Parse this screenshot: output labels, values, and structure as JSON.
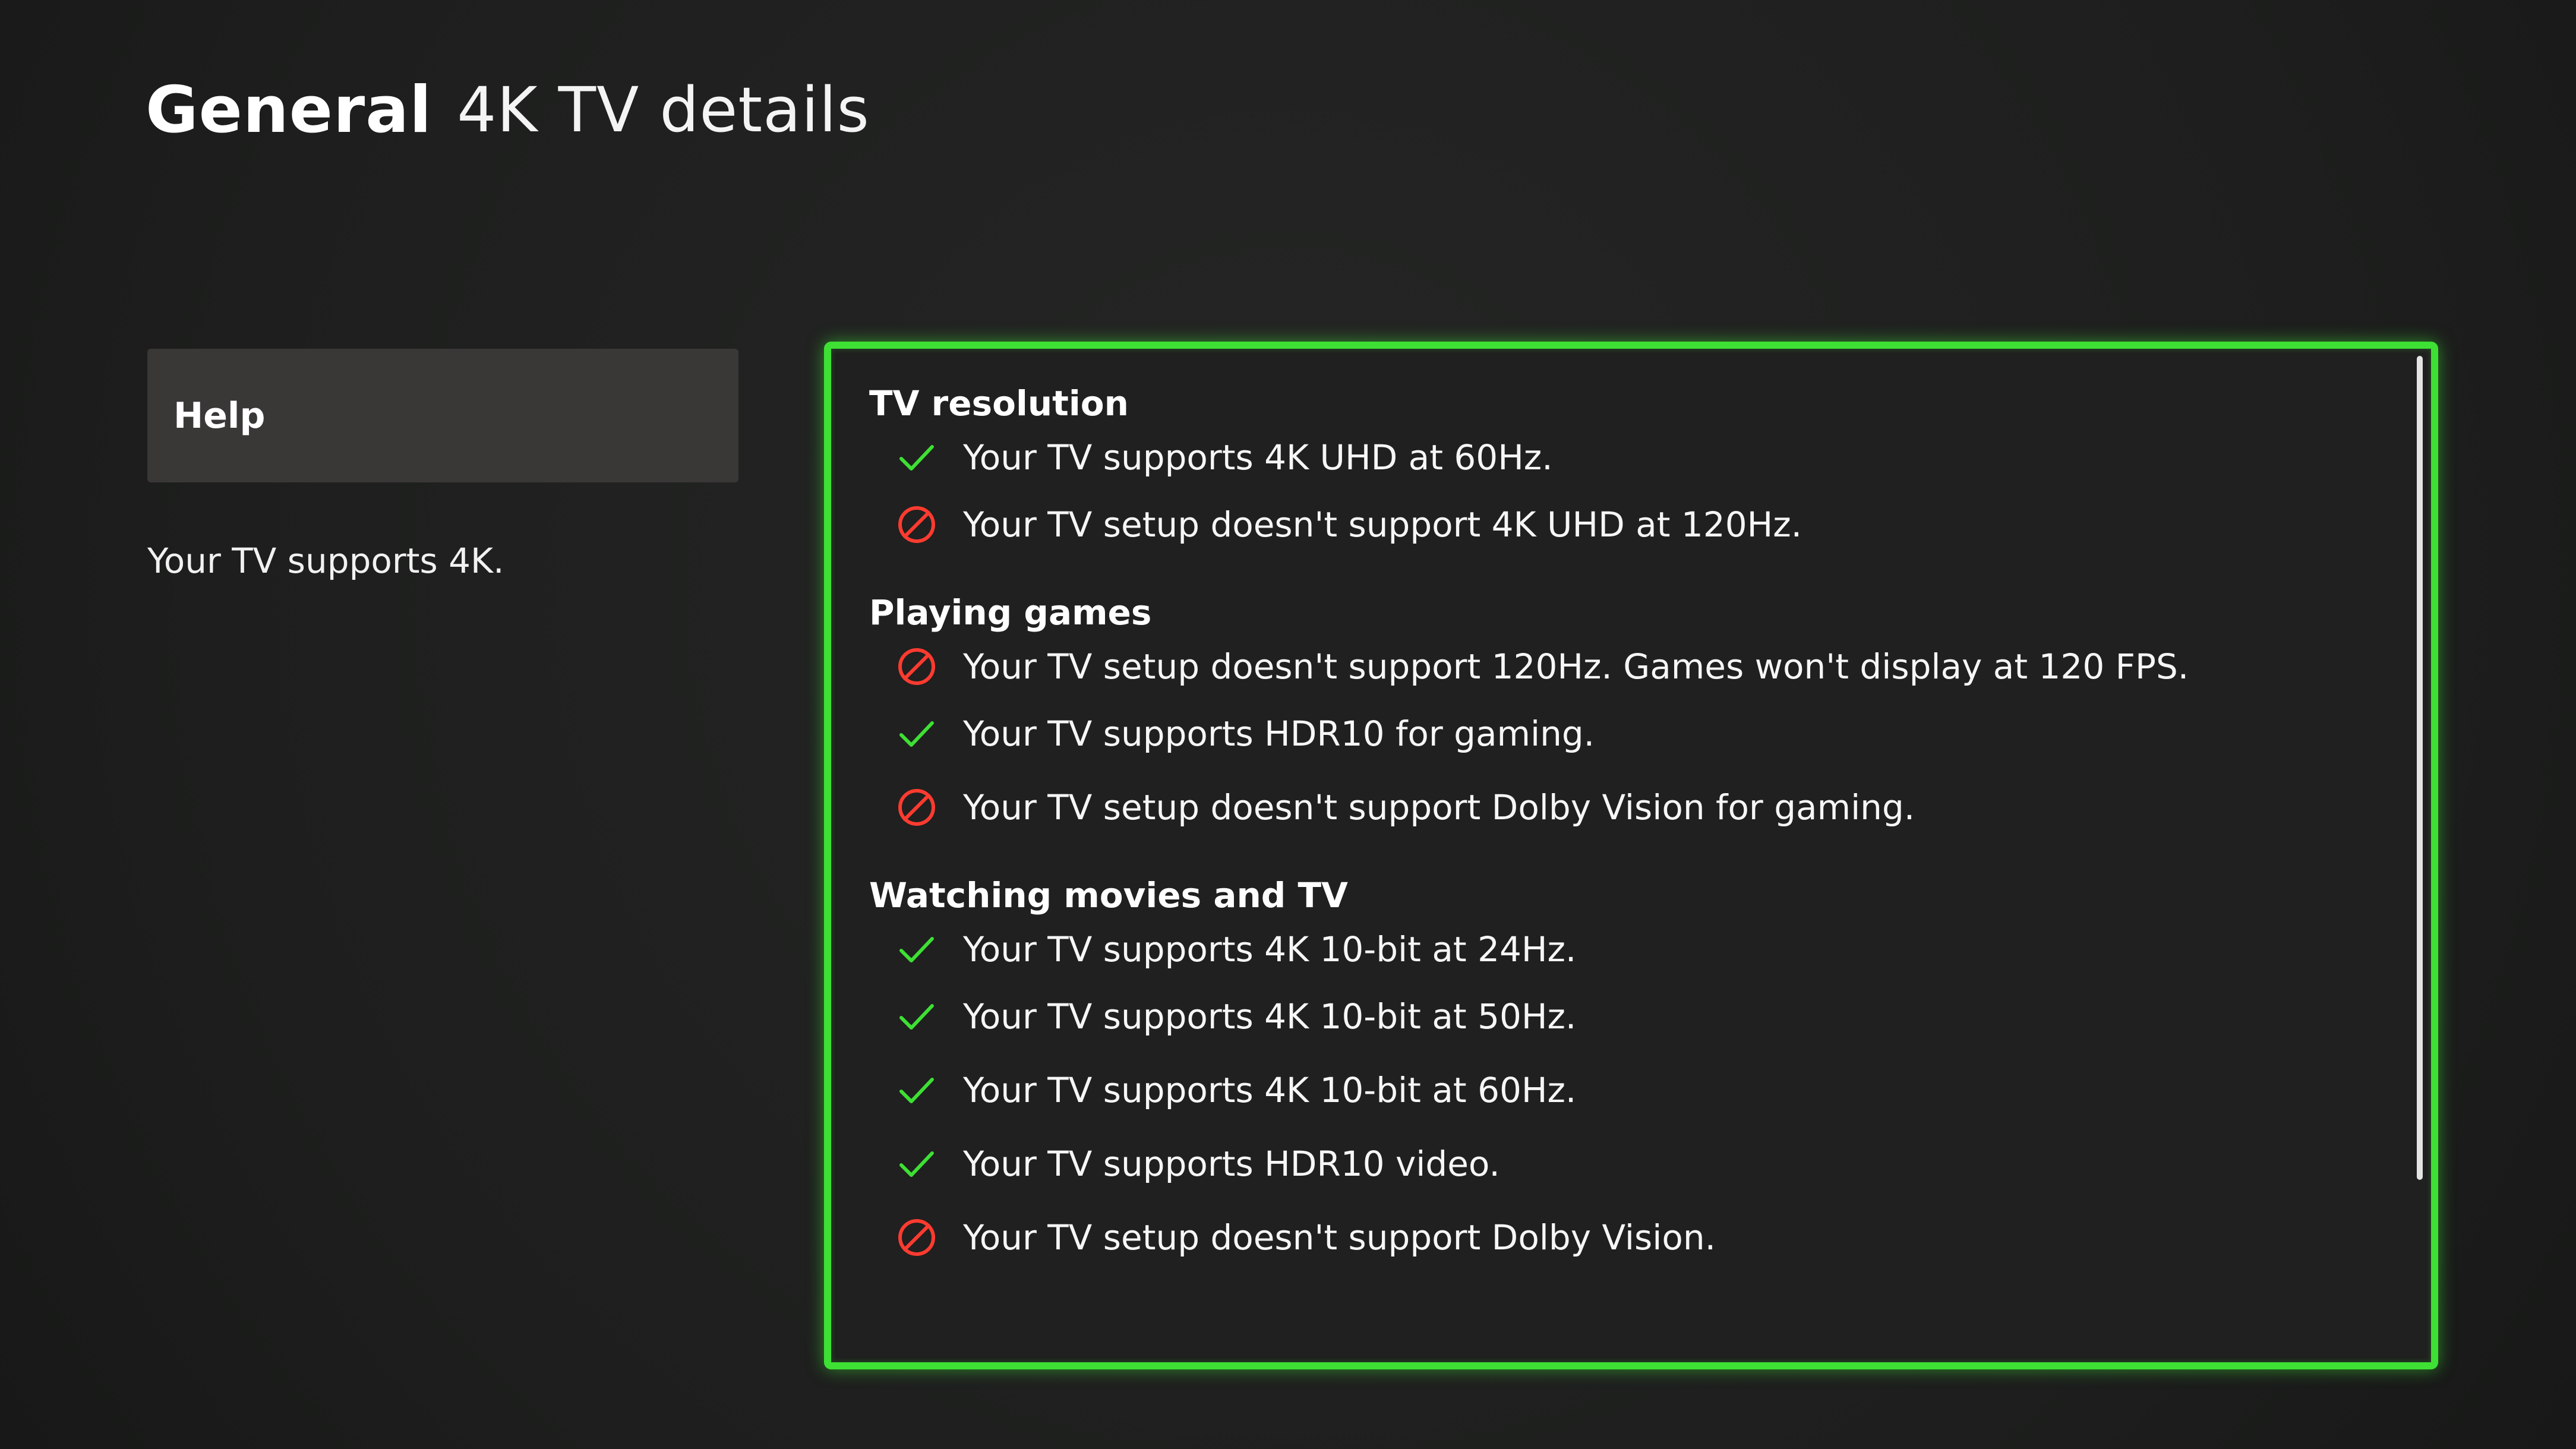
{
  "header": {
    "section": "General",
    "title": "4K TV details"
  },
  "left_pane": {
    "help_label": "Help",
    "summary": "Your TV supports 4K."
  },
  "colors": {
    "accent_green": "#3ee034",
    "unsupported_red": "#ff3b30",
    "background": "#1f201f"
  },
  "sections": [
    {
      "title": "TV resolution",
      "items": [
        {
          "status": "supported",
          "icon": "check-icon",
          "text": "Your TV supports 4K UHD at 60Hz."
        },
        {
          "status": "unsupported",
          "icon": "blocked-icon",
          "text": "Your TV setup doesn't support 4K UHD at 120Hz."
        }
      ]
    },
    {
      "title": "Playing games",
      "items": [
        {
          "status": "unsupported",
          "icon": "blocked-icon",
          "text": "Your TV setup doesn't support 120Hz. Games won't display at 120 FPS."
        },
        {
          "status": "supported",
          "icon": "check-icon",
          "text": "Your TV supports HDR10 for gaming."
        },
        {
          "status": "unsupported",
          "icon": "blocked-icon",
          "text": "Your TV setup doesn't support Dolby Vision for gaming."
        }
      ]
    },
    {
      "title": "Watching movies and TV",
      "items": [
        {
          "status": "supported",
          "icon": "check-icon",
          "text": "Your TV supports 4K 10-bit at 24Hz."
        },
        {
          "status": "supported",
          "icon": "check-icon",
          "text": "Your TV supports 4K 10-bit at 50Hz."
        },
        {
          "status": "supported",
          "icon": "check-icon",
          "text": "Your TV supports 4K 10-bit at 60Hz."
        },
        {
          "status": "supported",
          "icon": "check-icon",
          "text": "Your TV supports HDR10 video."
        },
        {
          "status": "unsupported",
          "icon": "blocked-icon",
          "text": "Your TV setup doesn't support Dolby Vision."
        }
      ]
    }
  ]
}
